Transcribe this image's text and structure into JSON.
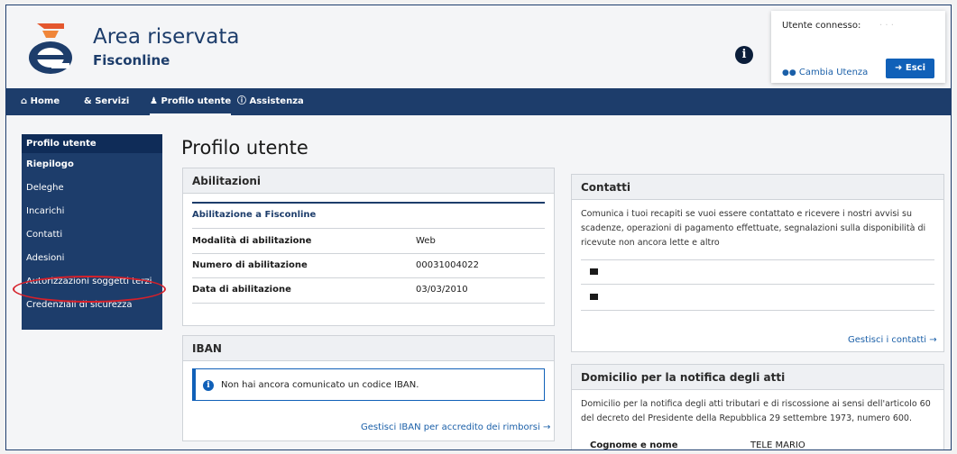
{
  "header": {
    "title": "Area riservata",
    "subtitle": "Fisconline",
    "user_label": "Utente connesso:",
    "user_name": "· · ·",
    "cambia_utenza": "Cambia Utenza",
    "esci": "Esci"
  },
  "nav": {
    "items": [
      {
        "label": "Home",
        "icon": "home-icon"
      },
      {
        "label": "Servizi",
        "icon": "servizi-icon"
      },
      {
        "label": "Profilo utente",
        "icon": "user-icon"
      },
      {
        "label": "Assistenza",
        "icon": "info-icon"
      }
    ]
  },
  "sidebar": {
    "heading": "Profilo utente",
    "items": [
      {
        "label": "Riepilogo"
      },
      {
        "label": "Deleghe"
      },
      {
        "label": "Incarichi"
      },
      {
        "label": "Contatti"
      },
      {
        "label": "Adesioni"
      },
      {
        "label": "Autorizzazioni soggetti terzi"
      },
      {
        "label": "Credenziali di sicurezza"
      }
    ]
  },
  "main": {
    "page_title": "Profilo utente",
    "abilitazioni": {
      "title": "Abilitazioni",
      "section": "Abilitazione a Fisconline",
      "rows": [
        {
          "label": "Modalità di abilitazione",
          "value": "Web"
        },
        {
          "label": "Numero di abilitazione",
          "value": "00031004022"
        },
        {
          "label": "Data di abilitazione",
          "value": "03/03/2010"
        }
      ]
    },
    "iban": {
      "title": "IBAN",
      "alert": "Non hai ancora comunicato un codice IBAN.",
      "link": "Gestisci IBAN per accredito dei rimborsi"
    },
    "contatti": {
      "title": "Contatti",
      "description": "Comunica i tuoi recapiti se vuoi essere contattato e ricevere i nostri avvisi su scadenze, operazioni di pagamento effettuate, segnalazioni sulla disponibilità di ricevute non ancora lette e altro",
      "link": "Gestisci i contatti"
    },
    "domicilio": {
      "title": "Domicilio per la notifica degli atti",
      "description": "Domicilio per la notifica degli atti tributari e di riscossione ai sensi dell'articolo 60 del decreto del Presidente della Repubblica 29 settembre 1973, numero 600.",
      "row_label": "Cognome e nome",
      "row_value": "TELE MARIO"
    }
  },
  "colors": {
    "brand": "#1d3d6b",
    "link": "#1a5fa8",
    "highlight": "#d6202a"
  }
}
